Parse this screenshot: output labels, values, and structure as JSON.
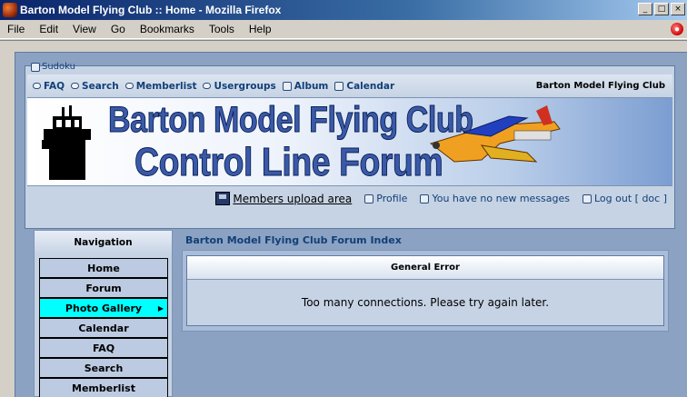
{
  "window": {
    "title": "Barton Model Flying Club :: Home - Mozilla Firefox",
    "buttons": [
      "_",
      "□",
      "×"
    ]
  },
  "menu": {
    "items": [
      "File",
      "Edit",
      "View",
      "Go",
      "Bookmarks",
      "Tools",
      "Help"
    ]
  },
  "header": {
    "sudoku": "Sudoku",
    "links": [
      "FAQ",
      "Search",
      "Memberlist",
      "Usergroups",
      "Album",
      "Calendar"
    ],
    "site_name": "Barton Model Flying Club",
    "banner_line1": "Barton Model Flying Club",
    "banner_line2": "Control Line Forum"
  },
  "userbar": {
    "upload": "Members upload area",
    "profile": "Profile",
    "messages": "You have no new messages",
    "logout": "Log out [ doc ]"
  },
  "sidebar": {
    "title": "Navigation",
    "items": [
      "Home",
      "Forum",
      "Photo Gallery",
      "Calendar",
      "FAQ",
      "Search",
      "Memberlist"
    ],
    "active_index": 2
  },
  "main": {
    "forum_index": "Barton Model Flying Club Forum Index",
    "error_title": "General Error",
    "error_message": "Too many connections. Please try again later."
  }
}
